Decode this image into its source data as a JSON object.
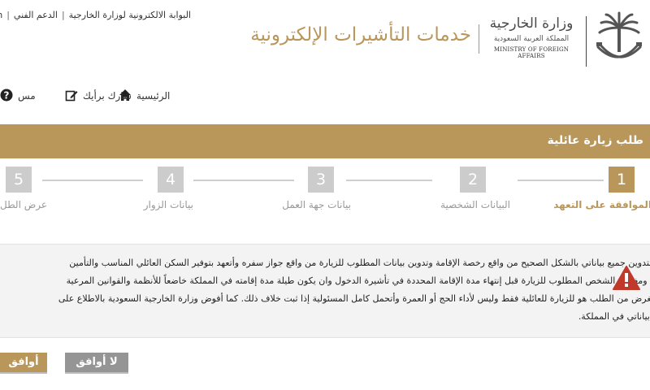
{
  "top_links": {
    "english": "sh",
    "portal": "البوابة الالكترونية لوزارة الخارجية",
    "support": "الدعم الفني",
    "separator": "|"
  },
  "header": {
    "ministry_arabic": "وزارة الخارجية",
    "kingdom_arabic": "المملكة العربية السعودية",
    "ministry_english": "MINISTRY OF FOREIGN AFFAIRS",
    "service_title": "خدمات التأشيرات الإلكترونية"
  },
  "nav": {
    "home": "الرئيسية",
    "share_opinion": "شارك برأيك",
    "help": "مس"
  },
  "page_title": "طلب زيارة عائلية",
  "steps": [
    {
      "number": "1",
      "label": "الموافقة على التعهد",
      "active": true
    },
    {
      "number": "2",
      "label": "البيانات الشخصية",
      "active": false
    },
    {
      "number": "3",
      "label": "بيانات جهة العمل",
      "active": false
    },
    {
      "number": "4",
      "label": "بيانات الزوار",
      "active": false
    },
    {
      "number": "5",
      "label": "عرض الطل",
      "active": false
    }
  ],
  "notice": {
    "lines": [
      "أتعهد بتدوين جميع بياناتي بالشكل الصحيح من واقع رخصة الإقامة وتدوين بيانات المطلوب للزيارة من واقع جواز سفره وأتعهد بتوفير السكن العائلي المناسب والتأمين",
      "الطبي ومغادرة الشخص المطلوب للزيارة قبل إنتهاء مدة الإقامة المحددة في تأشيرة الدخول وان يكون طيلة مدة إقامته في المملكة خاضعاً للأنظمة والقوانين المرعية",
      "وأن الغرض من الطلب هو للزيارة للعائلية فقط وليس لأداء الحج أو العمرة وأتحمل كامل المسئولية إذا ثبت خلاف ذلك. كما أفوض وزارة الخارجية السعودية بالاطلاع على",
      "سجل بياناتي في المملكة."
    ]
  },
  "buttons": {
    "agree": "أوافق",
    "disagree": "لا أوافق"
  },
  "colors": {
    "accent": "#b9975b",
    "inactive_step": "#cccccc",
    "warning": "#c0392b",
    "disagree_button": "#959595"
  }
}
